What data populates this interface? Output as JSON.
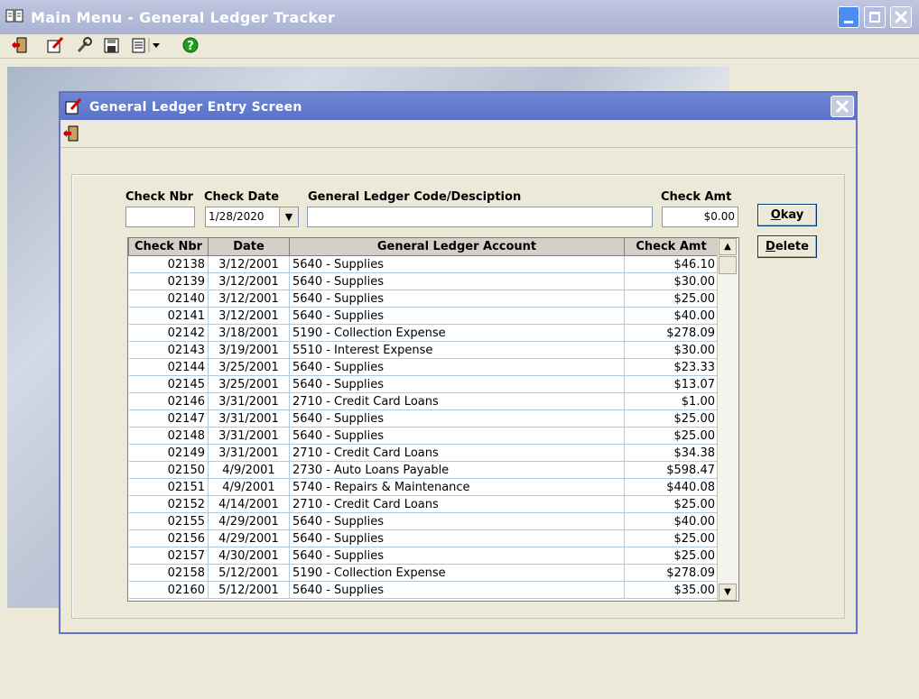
{
  "app": {
    "title": "Main Menu - General Ledger Tracker"
  },
  "dialog": {
    "title": "General Ledger Entry Screen"
  },
  "form": {
    "check_nbr_label": "Check Nbr",
    "check_date_label": "Check Date",
    "gl_code_label": "General Ledger Code/Desciption",
    "check_amt_label": "Check Amt",
    "check_nbr_value": "",
    "check_date_value": "1/28/2020",
    "gl_code_value": "",
    "check_amt_value": "$0.00",
    "okay_label": "Okay",
    "okay_mnemonic": "O",
    "okay_rest": "kay",
    "delete_label": "Delete",
    "delete_mnemonic": "D",
    "delete_rest": "elete"
  },
  "table": {
    "columns": [
      "Check Nbr",
      "Date",
      "General Ledger Account",
      "Check Amt"
    ],
    "rows": [
      [
        "02138",
        "3/12/2001",
        "5640 - Supplies",
        "$46.10"
      ],
      [
        "02139",
        "3/12/2001",
        "5640 - Supplies",
        "$30.00"
      ],
      [
        "02140",
        "3/12/2001",
        "5640 - Supplies",
        "$25.00"
      ],
      [
        "02141",
        "3/12/2001",
        "5640 - Supplies",
        "$40.00"
      ],
      [
        "02142",
        "3/18/2001",
        "5190 - Collection Expense",
        "$278.09"
      ],
      [
        "02143",
        "3/19/2001",
        "5510 - Interest Expense",
        "$30.00"
      ],
      [
        "02144",
        "3/25/2001",
        "5640 - Supplies",
        "$23.33"
      ],
      [
        "02145",
        "3/25/2001",
        "5640 - Supplies",
        "$13.07"
      ],
      [
        "02146",
        "3/31/2001",
        "2710 - Credit Card Loans",
        "$1.00"
      ],
      [
        "02147",
        "3/31/2001",
        "5640 - Supplies",
        "$25.00"
      ],
      [
        "02148",
        "3/31/2001",
        "5640 - Supplies",
        "$25.00"
      ],
      [
        "02149",
        "3/31/2001",
        "2710 - Credit Card Loans",
        "$34.38"
      ],
      [
        "02150",
        "4/9/2001",
        "2730 - Auto Loans Payable",
        "$598.47"
      ],
      [
        "02151",
        "4/9/2001",
        "5740 - Repairs & Maintenance",
        "$440.08"
      ],
      [
        "02152",
        "4/14/2001",
        "2710 - Credit Card Loans",
        "$25.00"
      ],
      [
        "02155",
        "4/29/2001",
        "5640 - Supplies",
        "$40.00"
      ],
      [
        "02156",
        "4/29/2001",
        "5640 - Supplies",
        "$25.00"
      ],
      [
        "02157",
        "4/30/2001",
        "5640 - Supplies",
        "$25.00"
      ],
      [
        "02158",
        "5/12/2001",
        "5190 - Collection Expense",
        "$278.09"
      ],
      [
        "02160",
        "5/12/2001",
        "5640 - Supplies",
        "$35.00"
      ]
    ]
  },
  "icons": {
    "exit": "exit-door-icon",
    "edit": "edit-entry-icon",
    "tools": "wrench-icon",
    "save": "save-disk-icon",
    "report": "report-icon",
    "help": "help-icon"
  }
}
